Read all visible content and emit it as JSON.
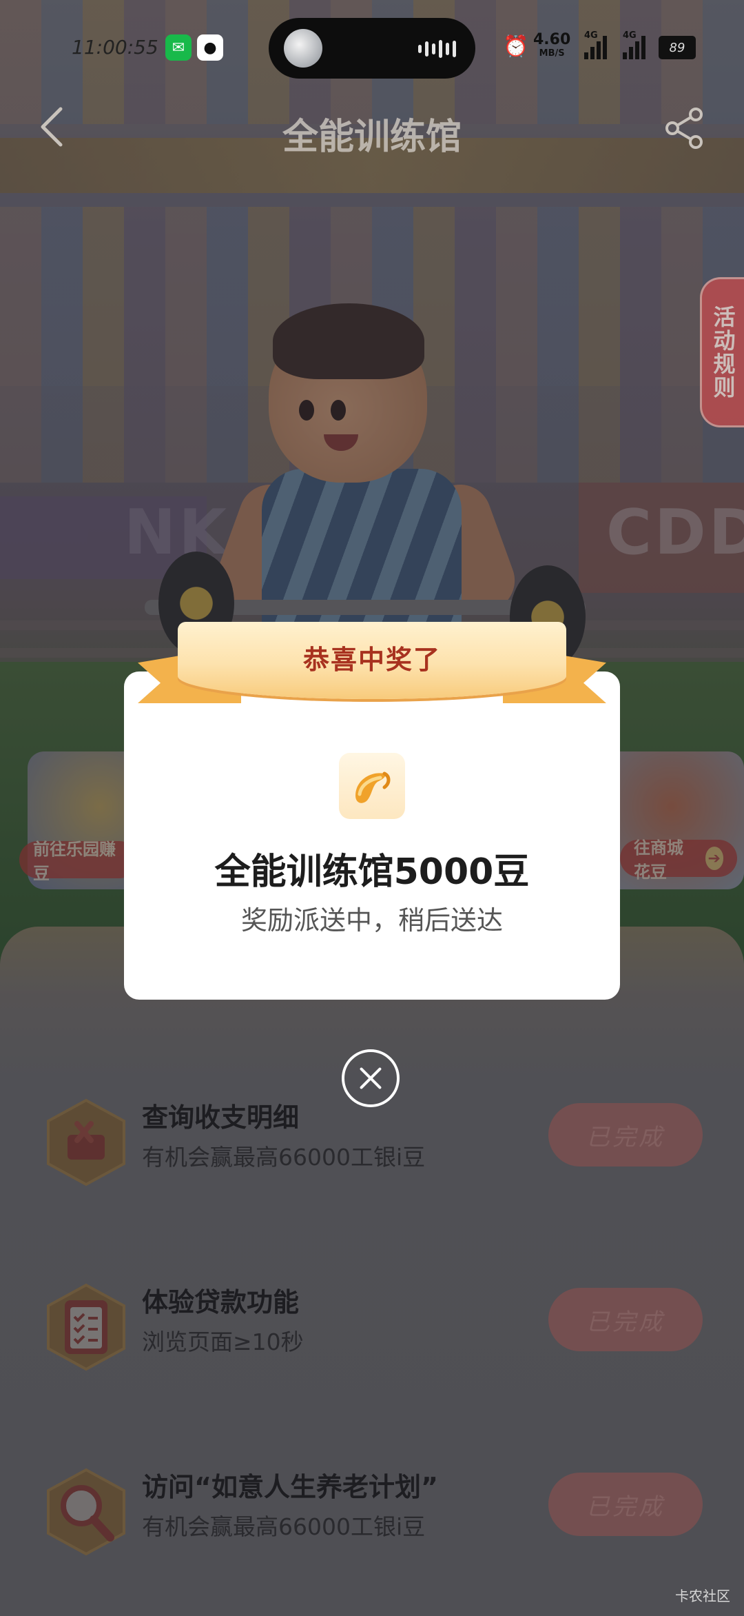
{
  "status_bar": {
    "time": "11:00:55",
    "net_speed": "4.60",
    "net_unit": "MB/S",
    "net1": "4G",
    "net2": "4G",
    "battery": "89"
  },
  "nav": {
    "title": "全能训练馆",
    "rules_label": "活动规则"
  },
  "scene": {
    "board_left": "NKAC",
    "board_right": "CDD",
    "pill_left": "前往乐园赚豆",
    "pill_right": "往商城花豆"
  },
  "modal": {
    "ribbon": "恭喜中奖了",
    "prize_title": "全能训练馆5000豆",
    "prize_subtitle": "奖励派送中，稍后送达"
  },
  "tasks": [
    {
      "title": "查询收支明细",
      "subtitle": "有机会赢最高66000工银i豆",
      "button": "已完成",
      "icon": "receipt-icon"
    },
    {
      "title": "体验贷款功能",
      "subtitle": "浏览页面≥10秒",
      "button": "已完成",
      "icon": "clipboard-icon"
    },
    {
      "title": "访问“如意人生养老计划”",
      "subtitle": "有机会赢最高66000工银i豆",
      "button": "已完成",
      "icon": "magnifier-icon"
    }
  ],
  "watermark": "卡农社区",
  "colors": {
    "ribbon_text": "#a8321f",
    "done_button": "#b3706a",
    "rules_tab": "#c94b4b"
  }
}
